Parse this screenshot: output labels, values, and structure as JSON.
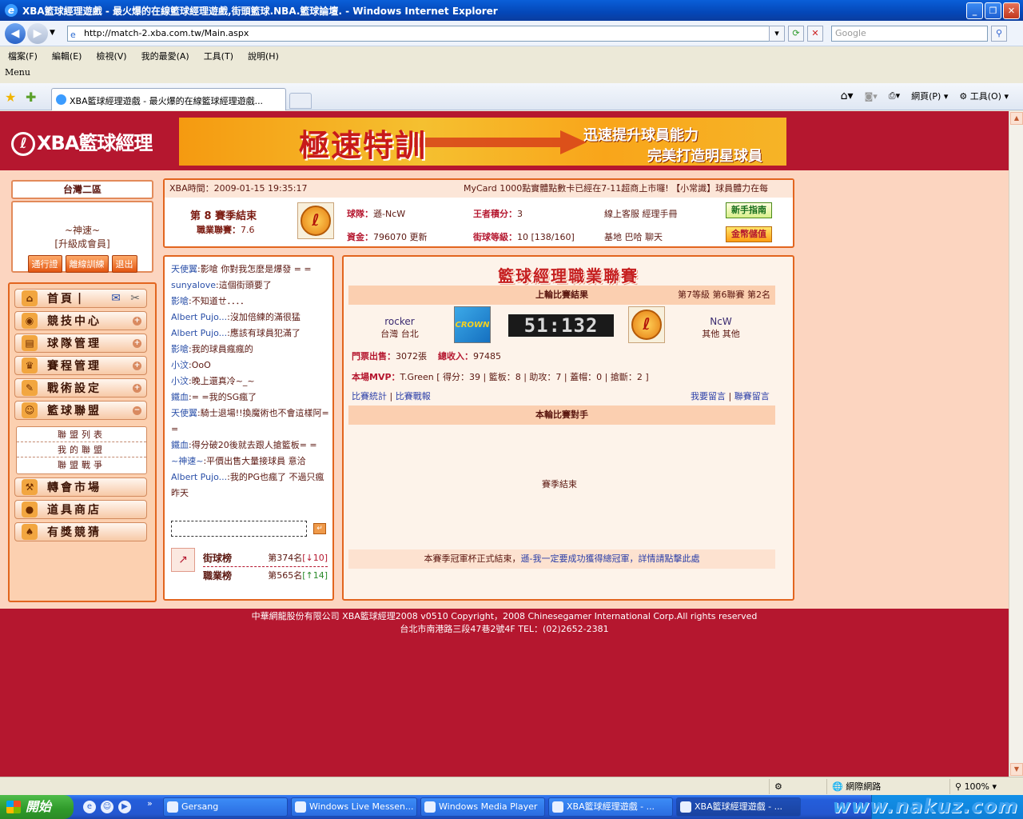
{
  "window": {
    "title": "XBA籃球經理遊戲 - 最火爆的在線籃球經理遊戲,街頭籃球.NBA.籃球論壇. - Windows Internet Explorer",
    "minimize": "_",
    "maximize": "❐",
    "close": "✕"
  },
  "address": {
    "url": "http://match-2.xba.com.tw/Main.aspx",
    "search_placeholder": "Google"
  },
  "menubar": {
    "items": [
      "檔案(F)",
      "編輯(E)",
      "檢視(V)",
      "我的最愛(A)",
      "工具(T)",
      "說明(H)"
    ],
    "menu_label": "Menu"
  },
  "tabs": {
    "active_tab": "XBA籃球經理遊戲 - 最火爆的在線籃球經理遊戲...",
    "cmd_page": "網頁(P)",
    "cmd_tools": "工具(O)"
  },
  "site": {
    "logo_text": "XBA籃球經理",
    "banner_big": "極速特訓",
    "banner_slogan1": "迅速提升球員能力",
    "banner_slogan2": "完美打造明星球員"
  },
  "sidebar": {
    "server": "台灣二區",
    "username": "~神速~",
    "user_level": "[升級成會員]",
    "buttons": [
      "通行證",
      "離線訓練",
      "退出"
    ],
    "menu": [
      {
        "label": "首頁",
        "icon": "home-icon"
      },
      {
        "label": "競技中心",
        "icon": "basketball-icon"
      },
      {
        "label": "球隊管理",
        "icon": "clipboard-icon"
      },
      {
        "label": "賽程管理",
        "icon": "trophy-icon"
      },
      {
        "label": "戰術設定",
        "icon": "tactics-icon"
      },
      {
        "label": "籃球聯盟",
        "icon": "league-icon"
      },
      {
        "label": "轉會市場",
        "icon": "gavel-icon"
      },
      {
        "label": "道具商店",
        "icon": "coins-icon"
      },
      {
        "label": "有獎競猜",
        "icon": "spade-icon"
      }
    ],
    "home_separator": "|",
    "submenu": [
      "聯盟列表",
      "我的聯盟",
      "聯盟戰爭"
    ]
  },
  "info": {
    "time_label": "XBA時間：",
    "time_value": "2009-01-15 19:35:17",
    "ticker": "MyCard 1000點實體點數卡已經在7-11超商上市囉! 【小常識】球員體力在每",
    "season": "第 8 賽季結束",
    "league_label": "職業聯賽：",
    "league_value": "7.6",
    "team_label": "球隊：",
    "team_value": "遜-NcW",
    "king_label": "王者積分：",
    "king_value": "3",
    "links_top": "線上客服  經理手冊",
    "money_label": "資金：",
    "money_value": "796070",
    "money_update": "更新",
    "street_label": "街球等級：",
    "street_value": "10 [138/160]",
    "links_bottom": "基地  巴哈  聊天",
    "btn_guide": "新手指南",
    "btn_gold": "金幣儲值"
  },
  "chat": {
    "messages": [
      {
        "user": "天使翼",
        "text": ":影嗆      你對我怎麼是爆發 =    ="
      },
      {
        "user": "sunyalove",
        "text": ":這個街頭要了"
      },
      {
        "user": "影嗆",
        "text": ":不知道ㄝ．．．．"
      },
      {
        "user": "Albert Pujo...",
        "text": ":沒加倍練的滿很猛"
      },
      {
        "user": "Albert Pujo...",
        "text": ":應該有球員犯滿了"
      },
      {
        "user": "影嗆",
        "text": ":我的球員瘋瘋的"
      },
      {
        "user": "小汶",
        "text": ":OoO"
      },
      {
        "user": "小汶",
        "text": ":晚上還真冷~_~"
      },
      {
        "user": "鐵血",
        "text": ":= =我的SG瘋了"
      },
      {
        "user": "天使翼",
        "text": ":騎士退場!!換魔術也不會這樣阿= ="
      },
      {
        "user": "鐵血",
        "text": ":得分破20後就去跟人搶籃板= ="
      },
      {
        "user": "~神速~",
        "text": ":平價出售大量接球員  意洽"
      },
      {
        "user": "Albert Pujo...",
        "text": ":我的PG也瘋了   不過只瘋昨天"
      }
    ],
    "send": "↵",
    "rank_street_label": "街球榜",
    "rank_street_value": "第374名",
    "rank_street_change": "[↓10]",
    "rank_pro_label": "職業榜",
    "rank_pro_value": "第565名",
    "rank_pro_change": "[↑14]"
  },
  "main": {
    "title": "籃球經理職業聯賽",
    "last_result": "上輪比賽結果",
    "division": "第7等級  第6聯賽  第2名",
    "home_team": "rocker",
    "home_loc": "台灣  台北",
    "home_logo": "CROWN",
    "score": "51:132",
    "away_team": "NcW",
    "away_loc": "其他  其他",
    "tickets_label": "門票出售：",
    "tickets_value": "3072張",
    "income_label": "總收入：",
    "income_value": "97485",
    "mvp_label": "本場MVP：",
    "mvp_value": "T.Green [ 得分：39 | 籃板：8 | 助攻：7 | 蓋帽：0 | 搶斷：2 ]",
    "link_stats": "比賽統計",
    "link_report": "比賽戰報",
    "link_msg": "我要留言",
    "link_league_msg": "聯賽留言",
    "link_sep": "|",
    "this_round": "本輪比賽對手",
    "season_end": "賽季結束",
    "notice_prefix": "本賽季冠軍杯正式結束，",
    "notice_link": "遜-我一定要成功獲得總冠軍，詳情請點擊此處"
  },
  "footer": {
    "line1": "中華網龍股份有限公司  XBA籃球經理2008 v0510    Copyright，2008 Chinesegamer International Corp.All rights reserved",
    "line2": "台北市南港路三段47巷2號4F TEL：(02)2652-2381"
  },
  "status": {
    "zone": "網際網路",
    "zoom": "100%"
  },
  "taskbar": {
    "start": "開始",
    "tasks": [
      "Gersang",
      "Windows Live Messen...",
      "Windows Media Player",
      "XBA籃球經理遊戲 - ...",
      "XBA籃球經理遊戲 - ..."
    ],
    "watermark": "www.nakuz.com"
  }
}
